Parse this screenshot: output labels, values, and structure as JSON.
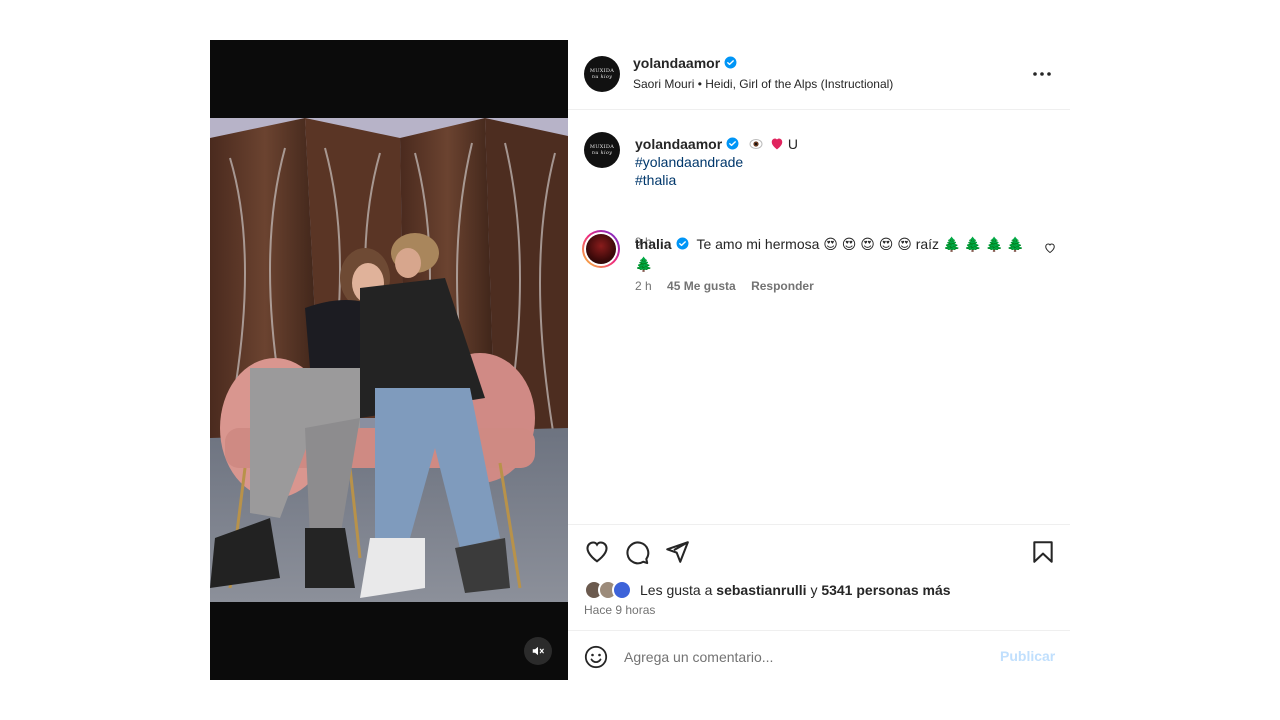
{
  "post": {
    "author": "yolandaamor",
    "avatar_logo_line1": "MUXIDA",
    "avatar_logo_line2": "nu kioy",
    "audio": "Saori Mouri • Heidi, Girl of the Alps (Instructional)"
  },
  "caption": {
    "author": "yolandaamor",
    "text_suffix": "U",
    "hashtags": [
      "#yolandaandrade",
      "#thalia"
    ],
    "time": "9 h"
  },
  "comment": {
    "author": "thalia",
    "text": "Te amo mi hermosa 😍 😍 😍 😍 😍  raíz 🌲 🌲 🌲 🌲 🌲",
    "time": "2 h",
    "likes": "45 Me gusta",
    "reply": "Responder"
  },
  "likes": {
    "prefix": "Les gusta a",
    "user": "sebastianrulli",
    "joiner": "y",
    "others": "5341 personas más"
  },
  "post_time": "Hace 9 horas",
  "comment_box": {
    "placeholder": "Agrega un comentario...",
    "publish": "Publicar"
  },
  "colors": {
    "verified": "#0095f6",
    "hashtag": "#00376b",
    "publish_disabled": "#c0dffd"
  },
  "icons": [
    "verified-icon",
    "more-icon",
    "heart-icon",
    "comment-icon",
    "share-icon",
    "bookmark-icon",
    "emoji-icon",
    "mute-icon"
  ]
}
